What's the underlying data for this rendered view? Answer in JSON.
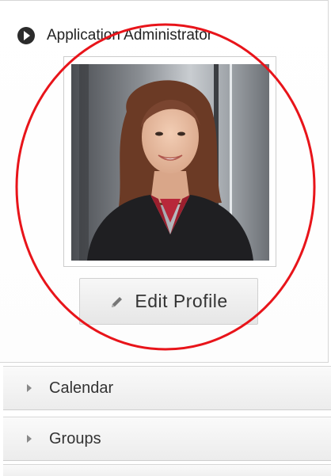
{
  "profile": {
    "role_title": "Application Administrator",
    "edit_label": "Edit Profile",
    "photo_icon": "user-photo",
    "header_icon": "play-circle-icon"
  },
  "accordion": {
    "items": [
      {
        "label": "Calendar"
      },
      {
        "label": "Groups"
      }
    ]
  },
  "colors": {
    "highlight_circle": "#e8141a",
    "button_bg": "#eeeeee",
    "row_bg": "#f3f3f3"
  }
}
